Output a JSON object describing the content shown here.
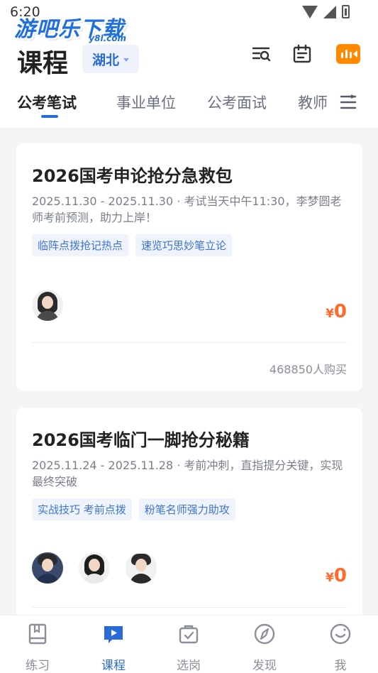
{
  "status_bar": {
    "time": "6:20"
  },
  "watermark": {
    "text": "游吧乐下载",
    "sub": "y8l.com"
  },
  "header": {
    "title": "课程",
    "region": "湖北"
  },
  "tabs": [
    {
      "label": "公考笔试",
      "active": true
    },
    {
      "label": "事业单位",
      "active": false
    },
    {
      "label": "公考面试",
      "active": false
    },
    {
      "label": "教师",
      "active": false
    }
  ],
  "courses": [
    {
      "title": "2026国考申论抢分急救包",
      "description": "2025.11.30 - 2025.11.30 · 考试当天中午11:30，李梦圆老师考前预测，助力上岸！",
      "tags": [
        "临阵点拨抢记热点",
        "速览巧思妙笔立论"
      ],
      "teacher_count": 1,
      "price_currency": "¥",
      "price_value": "0",
      "buyers": "468850人购买"
    },
    {
      "title": "2026国考临门一脚抢分秘籍",
      "description": "2025.11.24 - 2025.11.28 · 考前冲刺，直指提分关键，实现最终突破",
      "tags": [
        "实战技巧 考前点拨",
        "粉笔名师强力助攻"
      ],
      "teacher_count": 3,
      "price_currency": "¥",
      "price_value": "0"
    }
  ],
  "bottom_nav": [
    {
      "label": "练习",
      "icon": "book-icon",
      "active": false
    },
    {
      "label": "课程",
      "icon": "play-icon",
      "active": true
    },
    {
      "label": "选岗",
      "icon": "bag-check-icon",
      "active": false
    },
    {
      "label": "发现",
      "icon": "compass-icon",
      "active": false
    },
    {
      "label": "我",
      "icon": "smile-icon",
      "active": false
    }
  ],
  "colors": {
    "accent": "#2b6bd8",
    "price": "#ff6a2b",
    "live": "#ff8a00"
  }
}
